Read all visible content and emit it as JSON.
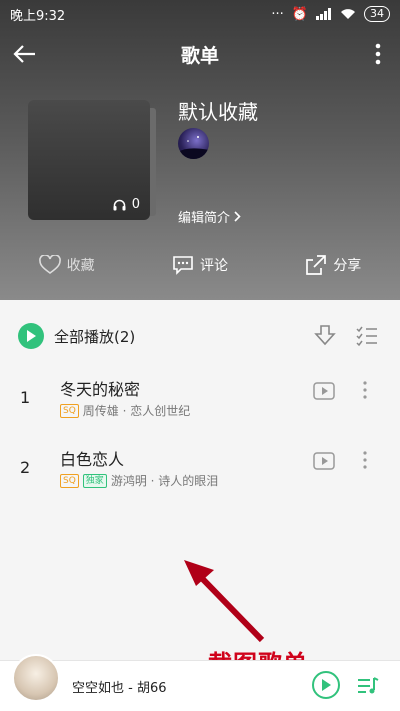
{
  "status": {
    "time": "晚上9:32",
    "battery": "34"
  },
  "titlebar": {
    "title": "歌单"
  },
  "playlist": {
    "name": "默认收藏",
    "play_count": "0",
    "edit_intro": "编辑简介"
  },
  "actions": [
    {
      "label": "收藏",
      "icon": "heart-icon"
    },
    {
      "label": "评论",
      "icon": "comment-icon"
    },
    {
      "label": "分享",
      "icon": "share-icon"
    }
  ],
  "list": {
    "play_all": "全部播放(2)",
    "songs": [
      {
        "index": "1",
        "name": "冬天的秘密",
        "tags": [
          "SQ"
        ],
        "artist_album": "周传雄 · 恋人创世纪"
      },
      {
        "index": "2",
        "name": "白色恋人",
        "tags": [
          "SQ",
          "独家"
        ],
        "artist_album": "游鸿明 · 诗人的眼泪"
      }
    ]
  },
  "annotation": {
    "text": "截图歌单"
  },
  "player": {
    "now_playing": "空空如也 - 胡66"
  },
  "colors": {
    "accent": "#31c27c",
    "annotation": "#d0021b",
    "sq_tag": "#f0a020"
  }
}
